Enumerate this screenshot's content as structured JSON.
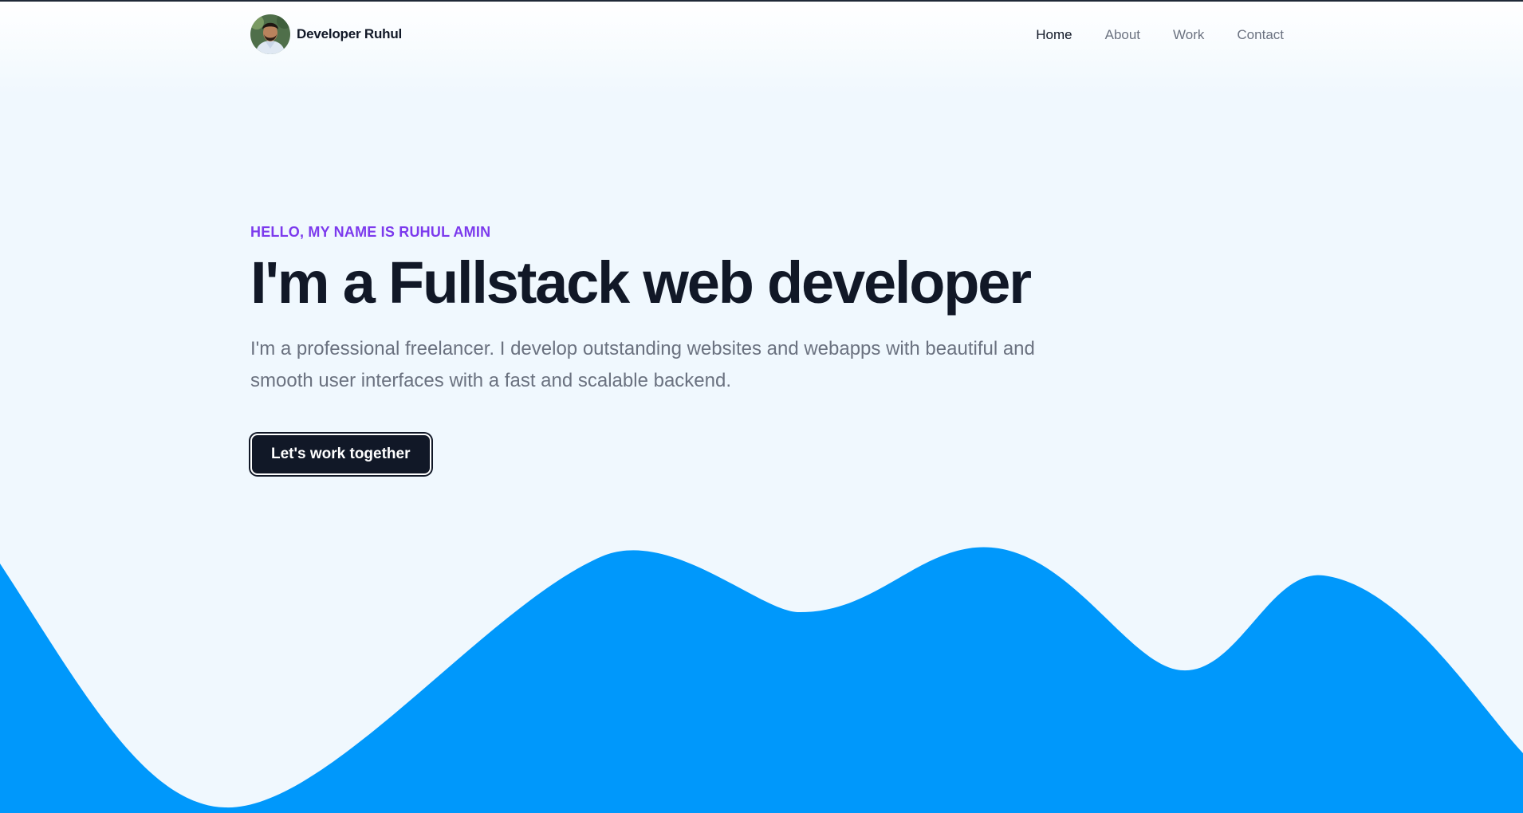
{
  "header": {
    "brand_name": "Developer Ruhul",
    "avatar_icon": "profile-photo-icon",
    "nav": {
      "home": "Home",
      "about": "About",
      "work": "Work",
      "contact": "Contact"
    }
  },
  "hero": {
    "eyebrow": "HELLO, MY NAME IS RUHUL AMIN",
    "headline": "I'm a Fullstack web developer",
    "description": "I'm a professional freelancer. I develop outstanding websites and webapps with beautiful and smooth user interfaces with a fast and scalable backend.",
    "cta_label": "Let's work together"
  },
  "colors": {
    "background": "#f0f8fe",
    "accent_purple": "#7c3aed",
    "wave_blue": "#0098fb",
    "button_dark": "#111827"
  }
}
